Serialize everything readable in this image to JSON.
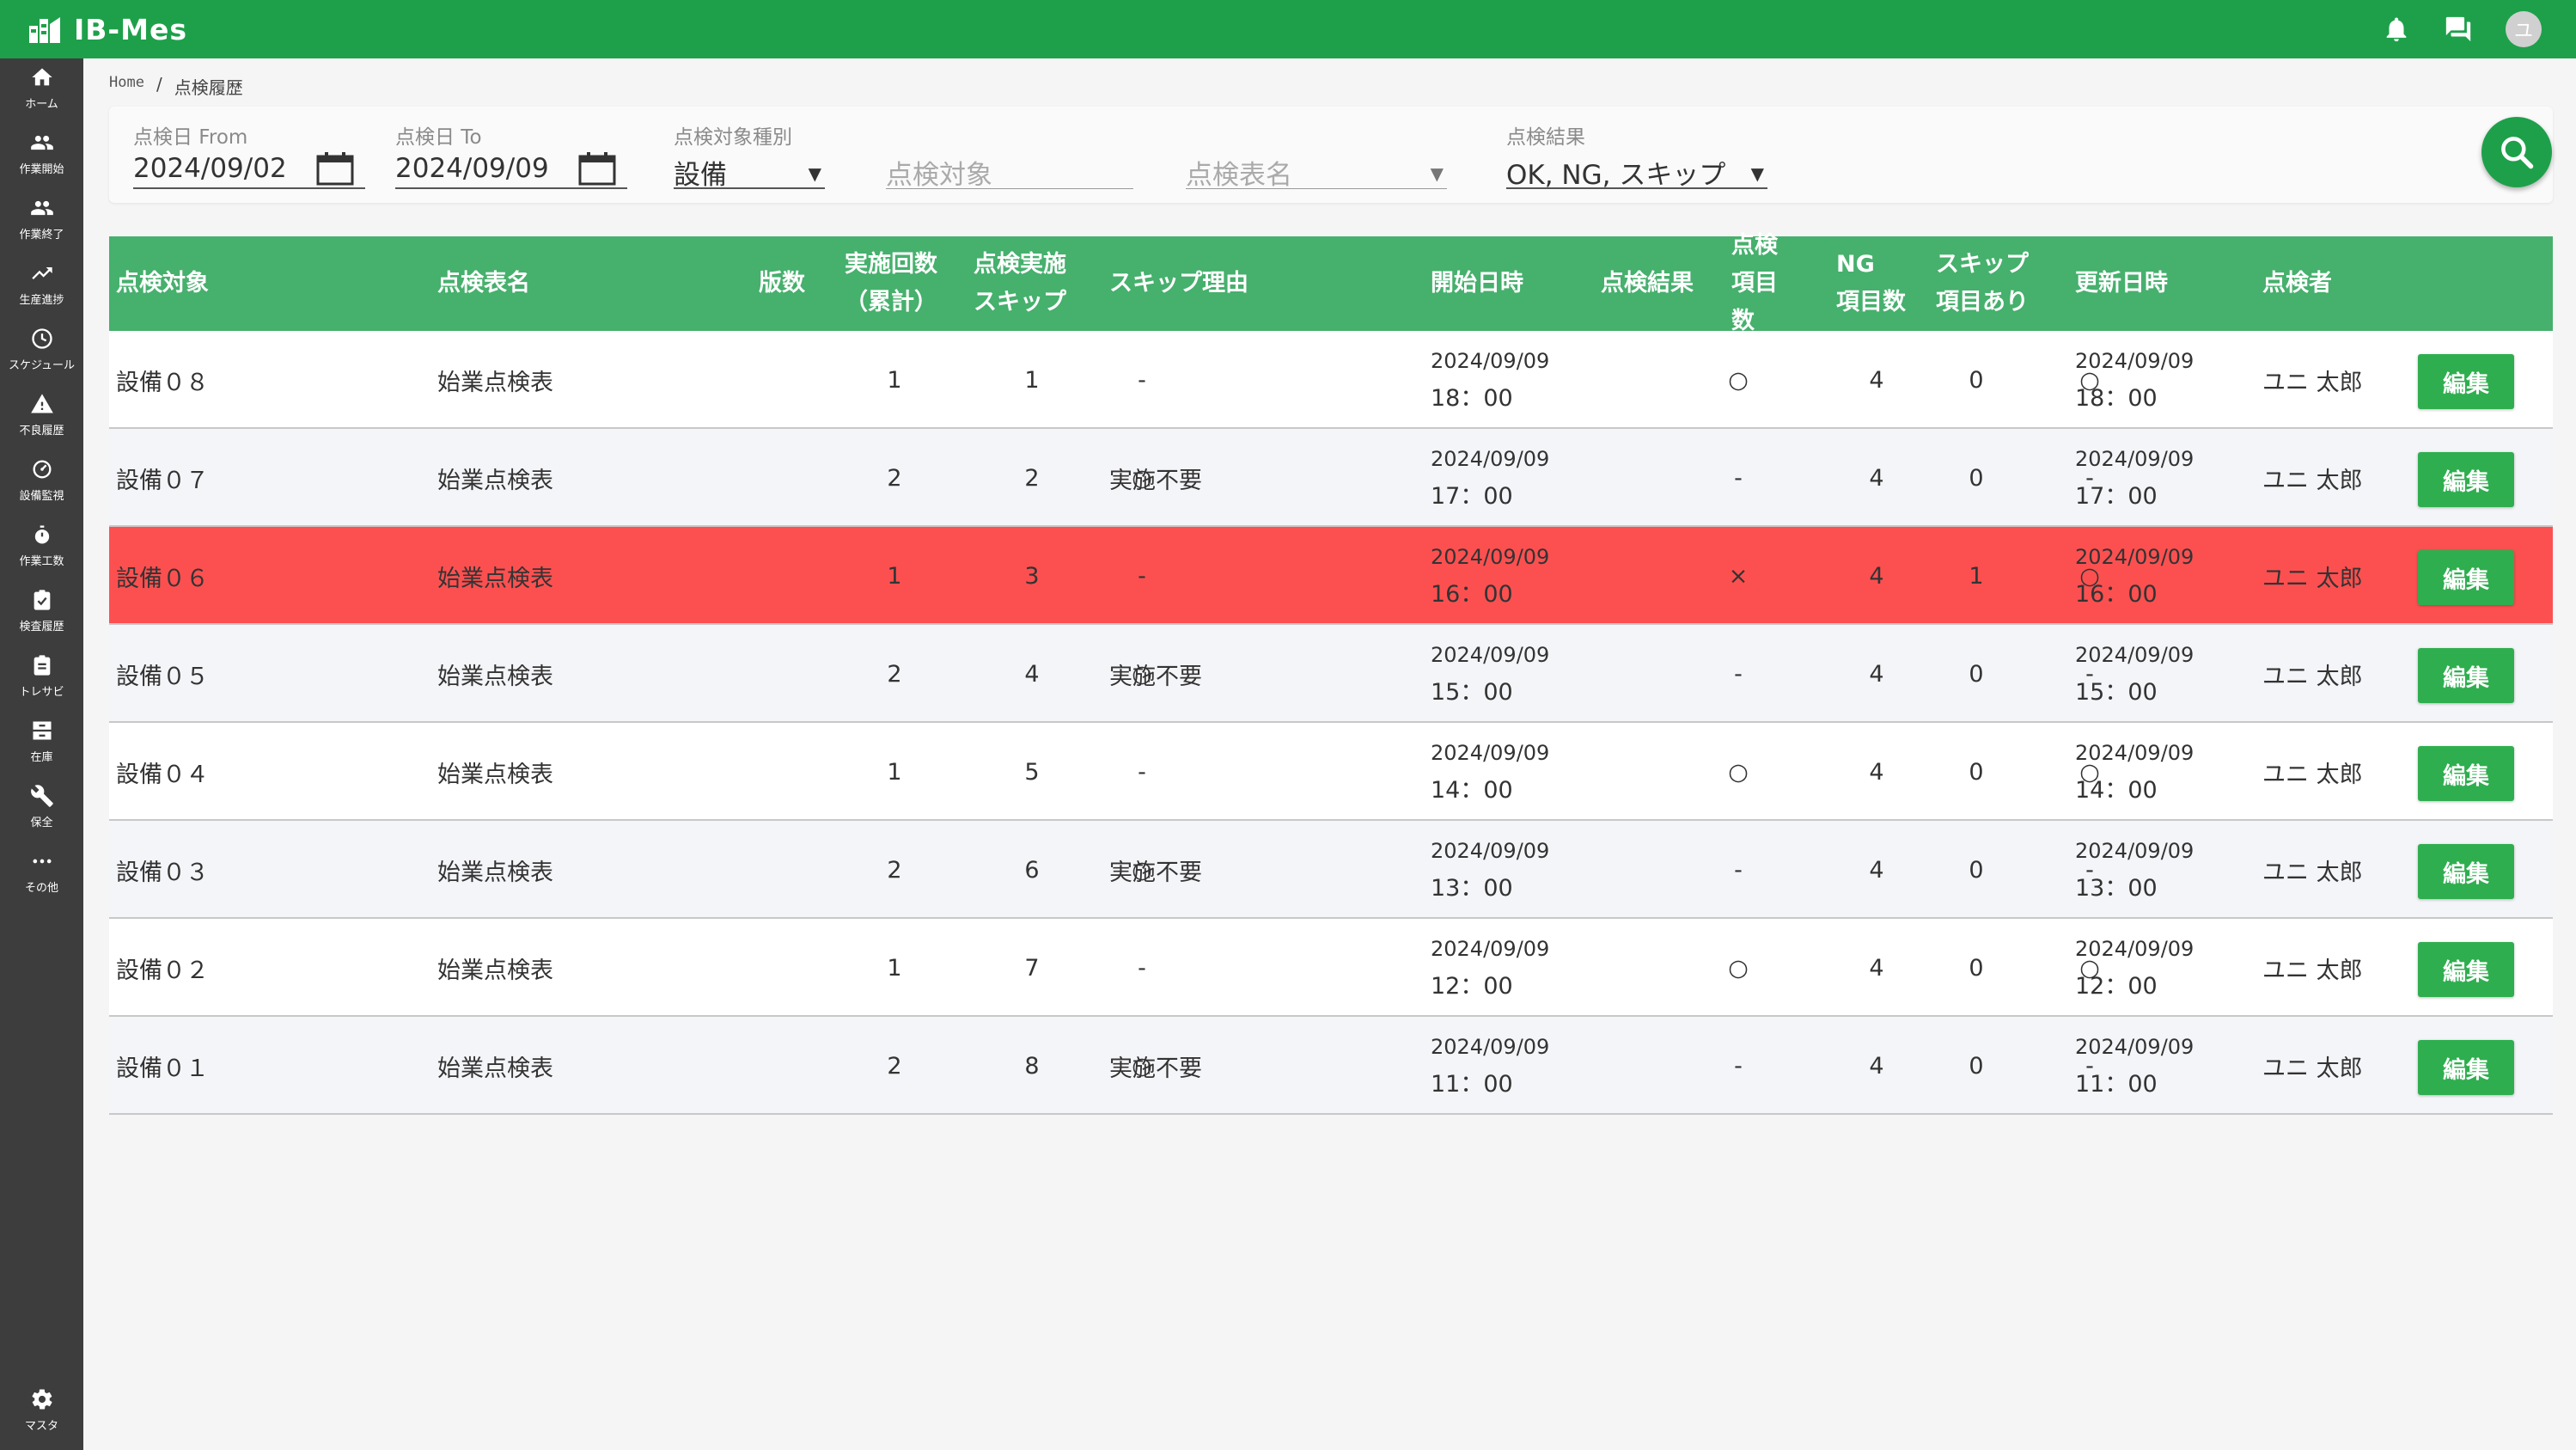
{
  "app": {
    "title": "IB-Mes",
    "avatar_initial": "ユ"
  },
  "colors": {
    "primary": "#1ea04a",
    "table_header": "#46b06d",
    "ng_row": "#fc5050",
    "sidebar": "#3d3d3d",
    "edit_button": "#2fae4f"
  },
  "sidebar": {
    "items": [
      {
        "label": "ホーム",
        "icon": "home-icon"
      },
      {
        "label": "作業開始",
        "icon": "group-icon"
      },
      {
        "label": "作業終了",
        "icon": "group-icon"
      },
      {
        "label": "生産進捗",
        "icon": "trending-up-icon"
      },
      {
        "label": "スケジュール",
        "icon": "clock-icon"
      },
      {
        "label": "不良履歴",
        "icon": "warning-icon"
      },
      {
        "label": "設備監視",
        "icon": "monitor-icon"
      },
      {
        "label": "作業工数",
        "icon": "stopwatch-icon"
      },
      {
        "label": "検査履歴",
        "icon": "clipboard-check-icon"
      },
      {
        "label": "トレサビ",
        "icon": "clipboard-icon"
      },
      {
        "label": "在庫",
        "icon": "inventory-icon"
      },
      {
        "label": "保全",
        "icon": "wrench-icon"
      },
      {
        "label": "その他",
        "icon": "more-icon"
      }
    ],
    "bottom": {
      "label": "マスタ",
      "icon": "gear-icon"
    }
  },
  "breadcrumb": {
    "home": "Home",
    "separator": "/",
    "current": "点検履歴"
  },
  "filters": {
    "date_from": {
      "label": "点検日 From",
      "value": "2024/09/02"
    },
    "date_to": {
      "label": "点検日 To",
      "value": "2024/09/09"
    },
    "target_type": {
      "label": "点検対象種別",
      "value": "設備"
    },
    "target": {
      "placeholder": "点検対象"
    },
    "sheet_name": {
      "placeholder": "点検表名"
    },
    "result": {
      "label": "点検結果",
      "value": "OK, NG, スキップ"
    }
  },
  "table": {
    "headers": {
      "target": "点検対象",
      "sheet": "点検表名",
      "version": "版数",
      "count_1": "実施回数",
      "count_2": "（累計）",
      "skip_1": "点検実施",
      "skip_2": "スキップ",
      "skip_reason": "スキップ理由",
      "start": "開始日時",
      "result": "点検結果",
      "items_1": "点検",
      "items_2": "項目数",
      "ng_1": "NG",
      "ng_2": "項目数",
      "skipitem_1": "スキップ",
      "skipitem_2": "項目あり",
      "updated": "更新日時",
      "inspector": "点検者"
    },
    "edit_label": "編集",
    "rows": [
      {
        "target": "設備０８",
        "sheet": "始業点検表",
        "version": "1",
        "count": "1",
        "skip": "-",
        "skip_reason": "",
        "start_date": "2024/09/09",
        "start_time": "18：00",
        "result": "○",
        "items": "4",
        "ng": "0",
        "skipitem": "○",
        "upd_date": "2024/09/09",
        "upd_time": "18：00",
        "inspector": "ユニ 太郎",
        "ng_row": false
      },
      {
        "target": "設備０７",
        "sheet": "始業点検表",
        "version": "2",
        "count": "2",
        "skip": "○",
        "skip_reason": "実施不要",
        "start_date": "2024/09/09",
        "start_time": "17：00",
        "result": "-",
        "items": "4",
        "ng": "0",
        "skipitem": "-",
        "upd_date": "2024/09/09",
        "upd_time": "17：00",
        "inspector": "ユニ 太郎",
        "ng_row": false
      },
      {
        "target": "設備０６",
        "sheet": "始業点検表",
        "version": "1",
        "count": "3",
        "skip": "-",
        "skip_reason": "",
        "start_date": "2024/09/09",
        "start_time": "16：00",
        "result": "×",
        "items": "4",
        "ng": "1",
        "skipitem": "○",
        "upd_date": "2024/09/09",
        "upd_time": "16：00",
        "inspector": "ユニ 太郎",
        "ng_row": true
      },
      {
        "target": "設備０５",
        "sheet": "始業点検表",
        "version": "2",
        "count": "4",
        "skip": "○",
        "skip_reason": "実施不要",
        "start_date": "2024/09/09",
        "start_time": "15：00",
        "result": "-",
        "items": "4",
        "ng": "0",
        "skipitem": "-",
        "upd_date": "2024/09/09",
        "upd_time": "15：00",
        "inspector": "ユニ 太郎",
        "ng_row": false
      },
      {
        "target": "設備０４",
        "sheet": "始業点検表",
        "version": "1",
        "count": "5",
        "skip": "-",
        "skip_reason": "",
        "start_date": "2024/09/09",
        "start_time": "14：00",
        "result": "○",
        "items": "4",
        "ng": "0",
        "skipitem": "○",
        "upd_date": "2024/09/09",
        "upd_time": "14：00",
        "inspector": "ユニ 太郎",
        "ng_row": false
      },
      {
        "target": "設備０３",
        "sheet": "始業点検表",
        "version": "2",
        "count": "6",
        "skip": "○",
        "skip_reason": "実施不要",
        "start_date": "2024/09/09",
        "start_time": "13：00",
        "result": "-",
        "items": "4",
        "ng": "0",
        "skipitem": "-",
        "upd_date": "2024/09/09",
        "upd_time": "13：00",
        "inspector": "ユニ 太郎",
        "ng_row": false
      },
      {
        "target": "設備０２",
        "sheet": "始業点検表",
        "version": "1",
        "count": "7",
        "skip": "-",
        "skip_reason": "",
        "start_date": "2024/09/09",
        "start_time": "12：00",
        "result": "○",
        "items": "4",
        "ng": "0",
        "skipitem": "○",
        "upd_date": "2024/09/09",
        "upd_time": "12：00",
        "inspector": "ユニ 太郎",
        "ng_row": false
      },
      {
        "target": "設備０１",
        "sheet": "始業点検表",
        "version": "2",
        "count": "8",
        "skip": "○",
        "skip_reason": "実施不要",
        "start_date": "2024/09/09",
        "start_time": "11：00",
        "result": "-",
        "items": "4",
        "ng": "0",
        "skipitem": "-",
        "upd_date": "2024/09/09",
        "upd_time": "11：00",
        "inspector": "ユニ 太郎",
        "ng_row": false
      }
    ]
  }
}
